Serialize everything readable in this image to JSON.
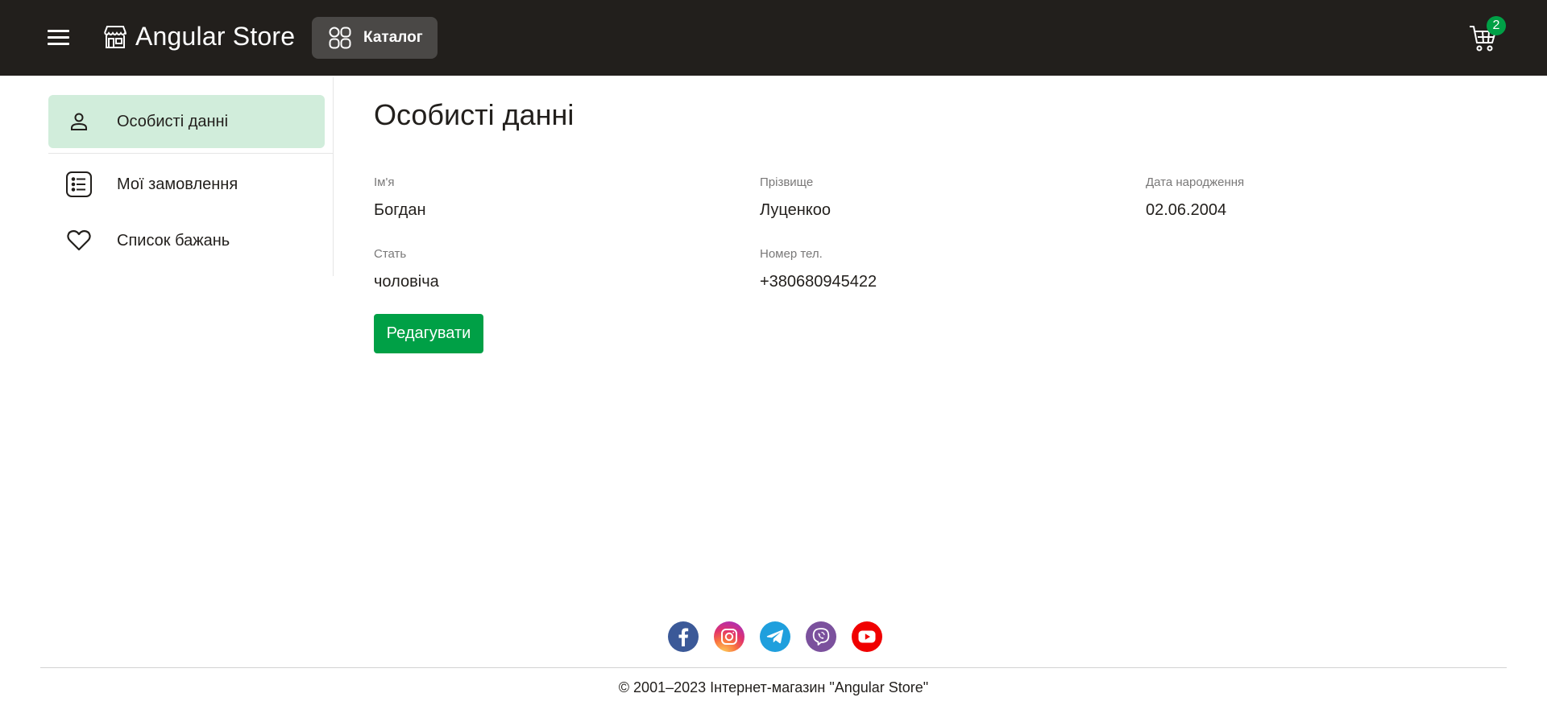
{
  "header": {
    "brand": "Angular Store",
    "catalog_label": "Каталог",
    "cart_count": "2",
    "icons": [
      "menu-icon",
      "store-icon",
      "catalog-grid-icon",
      "cart-icon"
    ]
  },
  "sidebar": {
    "items": [
      {
        "label": "Особисті данні",
        "icon": "user-icon",
        "active": true
      },
      {
        "label": "Мої замовлення",
        "icon": "list-icon",
        "active": false
      },
      {
        "label": "Список бажань",
        "icon": "heart-icon",
        "active": false
      }
    ]
  },
  "profile": {
    "title": "Особисті данні",
    "fields": [
      {
        "label": "Ім'я",
        "value": "Богдан"
      },
      {
        "label": "Прізвище",
        "value": "Луценкоо"
      },
      {
        "label": "Дата народження",
        "value": "02.06.2004"
      },
      {
        "label": "Стать",
        "value": "чоловіча"
      },
      {
        "label": "Номер тел.",
        "value": "+380680945422"
      }
    ],
    "edit_label": "Редагувати"
  },
  "footer": {
    "socials": [
      "facebook-icon",
      "instagram-icon",
      "telegram-icon",
      "viber-icon",
      "youtube-icon"
    ],
    "copyright": "© 2001–2023 Інтернет-магазин \"Angular Store\""
  },
  "colors": {
    "header_bg": "#221f1c",
    "accent": "#00a046",
    "active_item_bg": "#d1eddb"
  }
}
